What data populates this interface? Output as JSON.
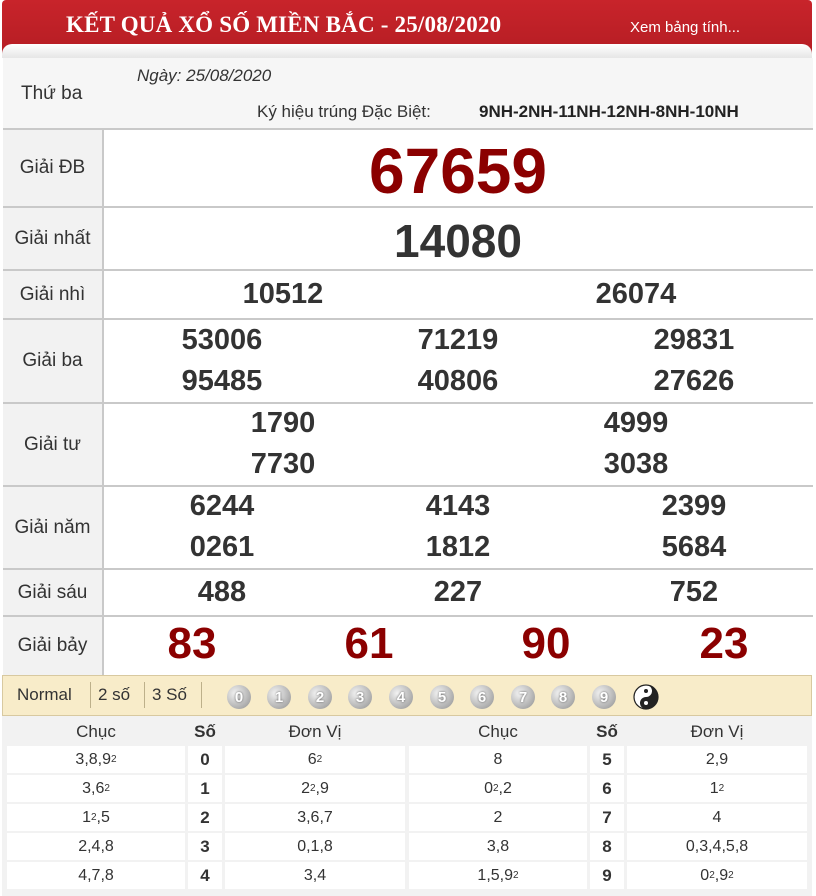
{
  "header": {
    "title": "KẾT QUẢ XỔ SỐ MIỀN BẮC - 25/08/2020",
    "link": "Xem bảng tính..."
  },
  "info": {
    "day": "Thứ ba",
    "date": "Ngày: 25/08/2020",
    "code_label": "Ký hiệu trúng Đặc Biệt:",
    "code": "9NH-2NH-11NH-12NH-8NH-10NH"
  },
  "prizes": [
    {
      "label": "Giải ĐB",
      "numbers": [
        "67659"
      ]
    },
    {
      "label": "Giải nhất",
      "numbers": [
        "14080"
      ]
    },
    {
      "label": "Giải nhì",
      "numbers": [
        "10512",
        "26074"
      ]
    },
    {
      "label": "Giải ba",
      "numbers": [
        "53006",
        "71219",
        "29831",
        "95485",
        "40806",
        "27626"
      ]
    },
    {
      "label": "Giải tư",
      "numbers": [
        "1790",
        "4999",
        "7730",
        "3038"
      ]
    },
    {
      "label": "Giải năm",
      "numbers": [
        "6244",
        "4143",
        "2399",
        "0261",
        "1812",
        "5684"
      ]
    },
    {
      "label": "Giải sáu",
      "numbers": [
        "488",
        "227",
        "752"
      ]
    },
    {
      "label": "Giải bảy",
      "numbers": [
        "83",
        "61",
        "90",
        "23"
      ]
    }
  ],
  "filter": {
    "buttons": [
      "Normal",
      "2 số",
      "3 Số"
    ],
    "digits": [
      "0",
      "1",
      "2",
      "3",
      "4",
      "5",
      "6",
      "7",
      "8",
      "9"
    ],
    "yinyang_icon": "yin-yang-icon"
  },
  "loto": {
    "headers": {
      "chuc": "Chục",
      "so": "Số",
      "donvi": "Đơn Vị"
    },
    "left": [
      {
        "chuc": [
          [
            "3"
          ],
          [
            "8"
          ],
          [
            "9",
            "2"
          ]
        ],
        "so": "0",
        "donvi": [
          [
            "6",
            "2"
          ]
        ]
      },
      {
        "chuc": [
          [
            "3"
          ],
          [
            "6",
            "2"
          ]
        ],
        "so": "1",
        "donvi": [
          [
            "2",
            "2"
          ],
          [
            "9"
          ]
        ]
      },
      {
        "chuc": [
          [
            "1",
            "2"
          ],
          [
            "5"
          ]
        ],
        "so": "2",
        "donvi": [
          [
            "3"
          ],
          [
            "6"
          ],
          [
            "7"
          ]
        ]
      },
      {
        "chuc": [
          [
            "2"
          ],
          [
            "4"
          ],
          [
            "8"
          ]
        ],
        "so": "3",
        "donvi": [
          [
            "0"
          ],
          [
            "1"
          ],
          [
            "8"
          ]
        ]
      },
      {
        "chuc": [
          [
            "4"
          ],
          [
            "7"
          ],
          [
            "8"
          ]
        ],
        "so": "4",
        "donvi": [
          [
            "3"
          ],
          [
            "4"
          ]
        ]
      }
    ],
    "right": [
      {
        "chuc": [
          [
            "8"
          ]
        ],
        "so": "5",
        "donvi": [
          [
            "2"
          ],
          [
            "9"
          ]
        ]
      },
      {
        "chuc": [
          [
            "0",
            "2"
          ],
          [
            "2"
          ]
        ],
        "so": "6",
        "donvi": [
          [
            "1",
            "2"
          ]
        ]
      },
      {
        "chuc": [
          [
            "2"
          ]
        ],
        "so": "7",
        "donvi": [
          [
            "4"
          ]
        ]
      },
      {
        "chuc": [
          [
            "3"
          ],
          [
            "8"
          ]
        ],
        "so": "8",
        "donvi": [
          [
            "0"
          ],
          [
            "3"
          ],
          [
            "4"
          ],
          [
            "5"
          ],
          [
            "8"
          ]
        ]
      },
      {
        "chuc": [
          [
            "1"
          ],
          [
            "5"
          ],
          [
            "9",
            "2"
          ]
        ],
        "so": "9",
        "donvi": [
          [
            "0",
            "2"
          ],
          [
            "9",
            "2"
          ]
        ]
      }
    ]
  },
  "colors": {
    "header_red": "#c8242b",
    "special_red": "#8b0000",
    "filter_bg": "#f8ecc9"
  }
}
